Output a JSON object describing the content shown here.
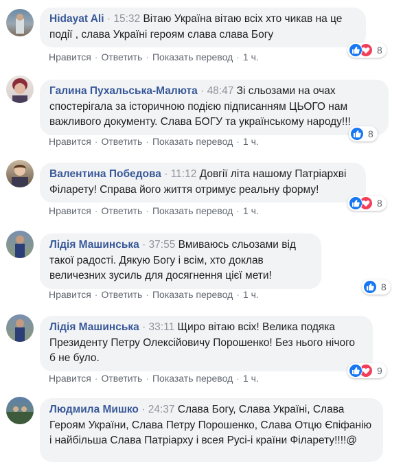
{
  "actions": {
    "like": "Нравится",
    "reply": "Ответить",
    "translate": "Показать перевод",
    "separator": "·"
  },
  "comments": [
    {
      "author": "Hidayat Ali",
      "time": "15:32",
      "text": "Вітаю Україна вітаю всіх хто чикав на це події , слава Україні героям слава слава Богу",
      "ago": "1 ч.",
      "reactions": 8,
      "reaction_types": [
        "like",
        "love"
      ]
    },
    {
      "author": "Галина Пухальська-Малюта",
      "time": "48:47",
      "text": "Зі сльозами на очах спостерігала за історичною подією підписанням ЦЬОГО нам важливого документу. Слава БОГУ та українському народу!!!",
      "ago": "1 ч.",
      "reactions": 8,
      "reaction_types": [
        "like"
      ]
    },
    {
      "author": "Валентина Победова",
      "time": "11:12",
      "text": "Довгії літа нашому Патріархві Філарету! Справа його життя отримує реальну форму!",
      "ago": "1 ч.",
      "reactions": 8,
      "reaction_types": [
        "like",
        "love"
      ]
    },
    {
      "author": "Лідія Машинська",
      "time": "37:55",
      "text": "Вмиваюсь сльозами від такої радості. Дякую Богу і всім, хто доклав величезних зусиль для досягнення цієї мети!",
      "ago": "1 ч.",
      "reactions": 8,
      "reaction_types": [
        "like"
      ]
    },
    {
      "author": "Лідія Машинська",
      "time": "33:11",
      "text": "Щиро вітаю всіх! Велика подяка Президенту Петру Олексійовичу Порошенко! Без нього нічого б не було.",
      "ago": "1 ч.",
      "reactions": 9,
      "reaction_types": [
        "like",
        "love"
      ]
    },
    {
      "author": "Людмила Мишко",
      "time": "24:37",
      "text": "Слава Богу, Слава Україні, Слава Героям України, Слава Петру Порошенко, Слава Отцю Єпіфанію і найбільша Слава Патріарху і всея Русі-і країни Філарету!!!!@",
      "ago": "",
      "reactions": null,
      "reaction_types": []
    }
  ],
  "colors": {
    "author": "#385898",
    "bubble": "#f2f3f5",
    "like": "#1877f2",
    "love": "#f33e58"
  }
}
